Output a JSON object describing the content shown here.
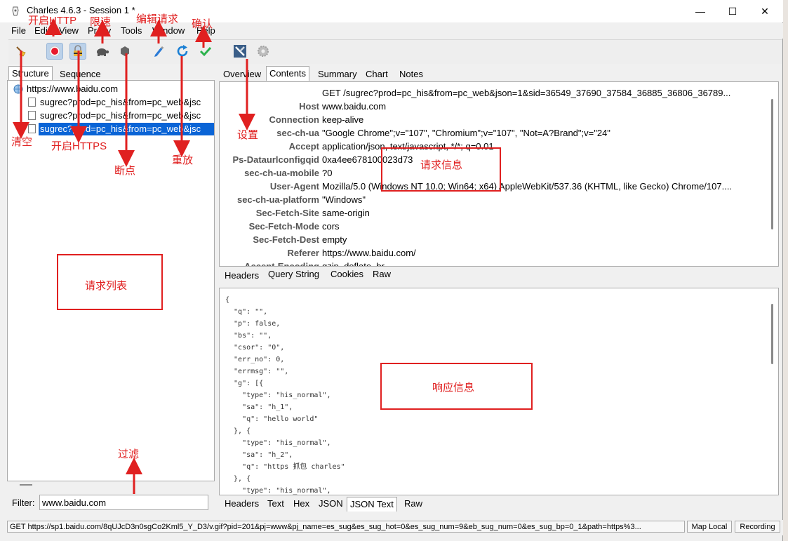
{
  "window": {
    "title": "Charles 4.6.3 - Session 1 *",
    "minimize": "—",
    "maximize": "☐",
    "close": "✕"
  },
  "menu": [
    "File",
    "Edit",
    "View",
    "Proxy",
    "Tools",
    "Window",
    "Help"
  ],
  "left": {
    "tabs": [
      "Structure",
      "Sequence"
    ],
    "host": "https://www.baidu.com",
    "requests": [
      "sugrec?prod=pc_his&from=pc_web&jsc",
      "sugrec?prod=pc_his&from=pc_web&jsc",
      "sugrec?prod=pc_his&from=pc_web&jsc"
    ],
    "filter_label": "Filter:",
    "filter_value": "www.baidu.com"
  },
  "right": {
    "tabs": [
      "Overview",
      "Contents",
      "Summary",
      "Chart",
      "Notes"
    ],
    "request_line": "GET /sugrec?prod=pc_his&from=pc_web&json=1&sid=36549_37690_37584_36885_36806_36789...",
    "headers": [
      {
        "k": "Host",
        "v": "www.baidu.com"
      },
      {
        "k": "Connection",
        "v": "keep-alive"
      },
      {
        "k": "sec-ch-ua",
        "v": "\"Google Chrome\";v=\"107\", \"Chromium\";v=\"107\", \"Not=A?Brand\";v=\"24\""
      },
      {
        "k": "Accept",
        "v": "application/json, text/javascript, */*; q=0.01"
      },
      {
        "k": "Ps-Dataurlconfigqid",
        "v": "0xa4ee678100023d73"
      },
      {
        "k": "sec-ch-ua-mobile",
        "v": "?0"
      },
      {
        "k": "User-Agent",
        "v": "Mozilla/5.0 (Windows NT 10.0; Win64; x64) AppleWebKit/537.36 (KHTML, like Gecko) Chrome/107...."
      },
      {
        "k": "sec-ch-ua-platform",
        "v": "\"Windows\""
      },
      {
        "k": "Sec-Fetch-Site",
        "v": "same-origin"
      },
      {
        "k": "Sec-Fetch-Mode",
        "v": "cors"
      },
      {
        "k": "Sec-Fetch-Dest",
        "v": "empty"
      },
      {
        "k": "Referer",
        "v": "https://www.baidu.com/"
      },
      {
        "k": "Accept-Encoding",
        "v": "gzip, deflate, br"
      }
    ],
    "req_subtabs": [
      "Headers",
      "Query String",
      "Cookies",
      "Raw"
    ],
    "json_lines": [
      "{",
      "  \"q\": \"\",",
      "  \"p\": false,",
      "  \"bs\": \"\",",
      "  \"csor\": \"0\",",
      "  \"err_no\": 0,",
      "  \"errmsg\": \"\",",
      "  \"g\": [{",
      "    \"type\": \"his_normal\",",
      "    \"sa\": \"h_1\",",
      "    \"q\": \"hello world\"",
      "  }, {",
      "    \"type\": \"his_normal\",",
      "    \"sa\": \"h_2\",",
      "    \"q\": \"https 抓包 charles\"",
      "  }, {",
      "    \"type\": \"his_normal\","
    ],
    "resp_subtabs": [
      "Headers",
      "Text",
      "Hex",
      "JSON",
      "JSON Text",
      "Raw"
    ]
  },
  "status": {
    "text": "GET https://sp1.baidu.com/8qUJcD3n0sgCo2Kml5_Y_D3/v.gif?pid=201&pj=www&pj_name=es_sug&es_sug_hot=0&es_sug_num=9&eb_sug_num=0&es_sug_bp=0_1&path=https%3...",
    "map_local": "Map Local",
    "recording": "Recording"
  },
  "annotations": {
    "start_http": "开启HTTP",
    "throttle": "限速",
    "edit_request": "编辑请求",
    "confirm": "确认",
    "clear": "清空",
    "start_https": "开启HTTPS",
    "breakpoint": "断点",
    "replay": "重放",
    "settings": "设置",
    "request_info": "请求信息",
    "request_list": "请求列表",
    "response_info": "响应信息",
    "filter": "过滤"
  },
  "colors": {
    "annotation": "#e02020",
    "selection": "#0a64d6",
    "record": "#e8192c",
    "confirm": "#2bb24c",
    "replay": "#1a7fd4"
  }
}
